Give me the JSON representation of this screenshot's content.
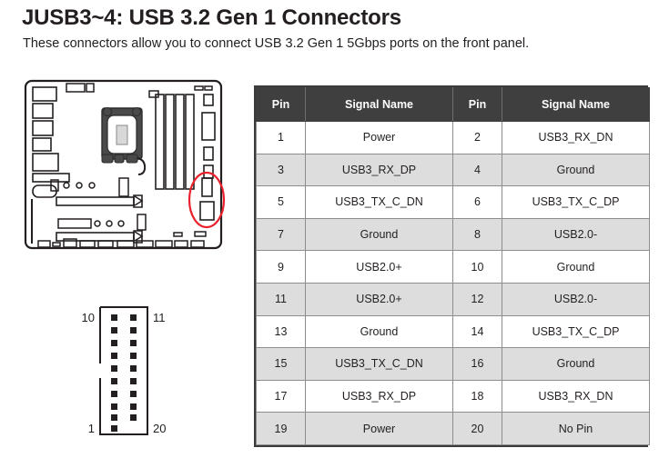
{
  "header": {
    "title": "JUSB3~4: USB 3.2 Gen 1 Connectors",
    "subtitle": "These connectors allow you to connect USB 3.2 Gen 1 5Gbps ports on the front panel."
  },
  "figures": {
    "motherboard": {
      "name": "motherboard-diagram",
      "highlight_color": "#e8212b",
      "highlight_label": "JUSB3~4 connector location"
    },
    "connector": {
      "name": "connector-pinout-diagram",
      "labels": {
        "top_left": "10",
        "top_right": "11",
        "bottom_left": "1",
        "bottom_right": "20"
      },
      "total_pins": 20,
      "rows": 10,
      "missing_pin": 20
    }
  },
  "table": {
    "columns": [
      "Pin",
      "Signal Name",
      "Pin",
      "Signal Name"
    ],
    "rows": [
      {
        "pin_a": "1",
        "signal_a": "Power",
        "pin_b": "2",
        "signal_b": "USB3_RX_DN"
      },
      {
        "pin_a": "3",
        "signal_a": "USB3_RX_DP",
        "pin_b": "4",
        "signal_b": "Ground"
      },
      {
        "pin_a": "5",
        "signal_a": "USB3_TX_C_DN",
        "pin_b": "6",
        "signal_b": "USB3_TX_C_DP"
      },
      {
        "pin_a": "7",
        "signal_a": "Ground",
        "pin_b": "8",
        "signal_b": "USB2.0-"
      },
      {
        "pin_a": "9",
        "signal_a": "USB2.0+",
        "pin_b": "10",
        "signal_b": "Ground"
      },
      {
        "pin_a": "11",
        "signal_a": "USB2.0+",
        "pin_b": "12",
        "signal_b": "USB2.0-"
      },
      {
        "pin_a": "13",
        "signal_a": "Ground",
        "pin_b": "14",
        "signal_b": "USB3_TX_C_DP"
      },
      {
        "pin_a": "15",
        "signal_a": "USB3_TX_C_DN",
        "pin_b": "16",
        "signal_b": "Ground"
      },
      {
        "pin_a": "17",
        "signal_a": "USB3_RX_DP",
        "pin_b": "18",
        "signal_b": "USB3_RX_DN"
      },
      {
        "pin_a": "19",
        "signal_a": "Power",
        "pin_b": "20",
        "signal_b": "No Pin"
      }
    ]
  },
  "colors": {
    "header_bg": "#3f3f3f",
    "header_text": "#ffffff",
    "row_alt_bg": "#dddddd",
    "row_bg": "#ffffff",
    "text": "#231f20",
    "highlight": "#e8212b"
  }
}
